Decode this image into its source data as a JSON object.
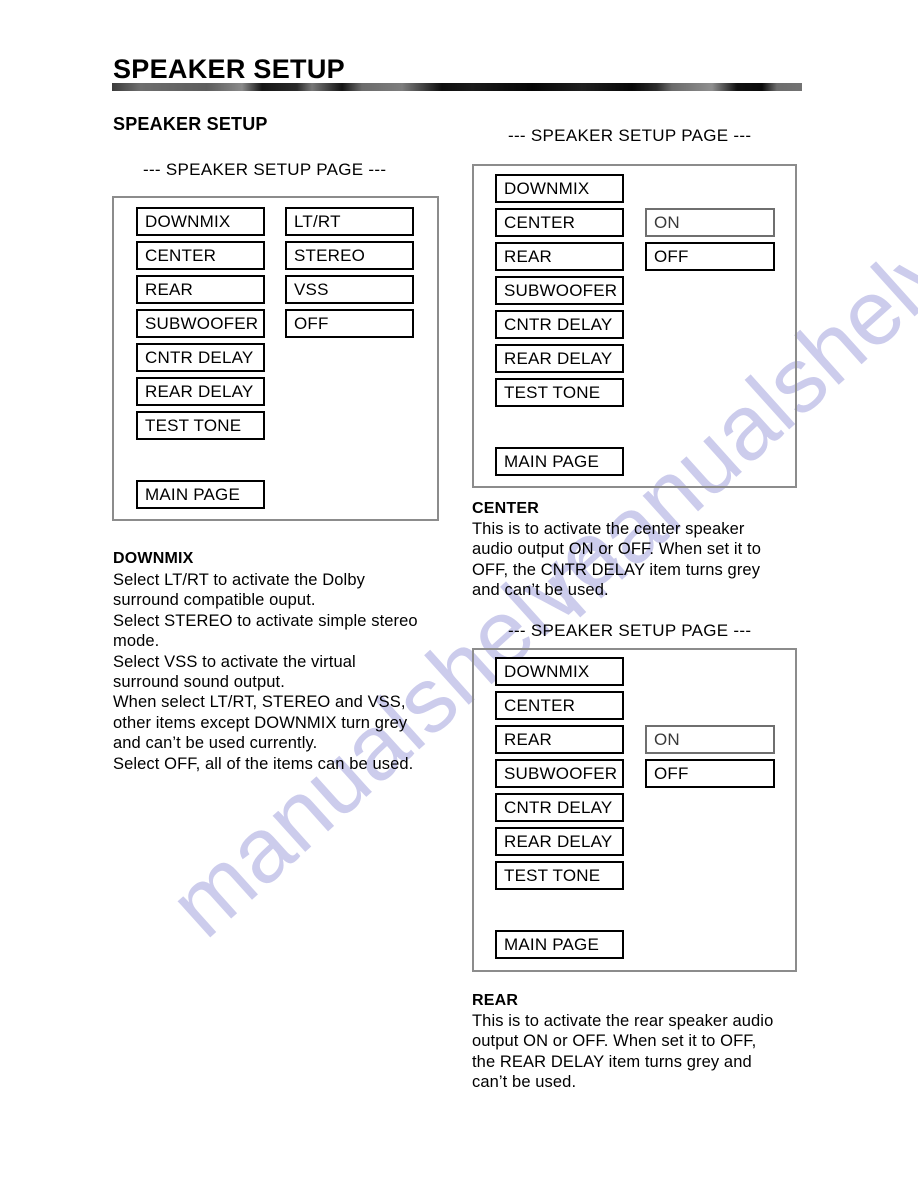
{
  "document": {
    "title": "SPEAKER SETUP",
    "section_heading": "SPEAKER SETUP"
  },
  "panels": [
    {
      "id": "downmix-panel",
      "heading": "--- SPEAKER SETUP PAGE ---",
      "menu_items": [
        "DOWNMIX",
        "CENTER",
        "REAR",
        "SUBWOOFER",
        "CNTR DELAY",
        "REAR DELAY",
        "TEST TONE"
      ],
      "main_page_label": "MAIN PAGE",
      "options": [
        "LT/RT",
        "STEREO",
        "VSS",
        "OFF"
      ]
    },
    {
      "id": "center-panel",
      "heading": "--- SPEAKER SETUP PAGE ---",
      "menu_items": [
        "DOWNMIX",
        "CENTER",
        "REAR",
        "SUBWOOFER",
        "CNTR DELAY",
        "REAR DELAY",
        "TEST TONE"
      ],
      "main_page_label": "MAIN PAGE",
      "options": [
        "ON",
        "OFF"
      ]
    },
    {
      "id": "rear-panel",
      "heading": "--- SPEAKER SETUP PAGE ---",
      "menu_items": [
        "DOWNMIX",
        "CENTER",
        "REAR",
        "SUBWOOFER",
        "CNTR DELAY",
        "REAR DELAY",
        "TEST TONE"
      ],
      "main_page_label": "MAIN PAGE",
      "options": [
        "ON",
        "OFF"
      ]
    }
  ],
  "captions": {
    "downmix": {
      "title": "DOWNMIX",
      "body": "Select LT/RT to activate the Dolby\nsurround compatible ouput.\nSelect STEREO to activate simple stereo\nmode.\nSelect VSS to activate the virtual\nsurround sound output.\nWhen select LT/RT, STEREO and VSS,\nother items except DOWNMIX turn grey\nand can’t be used currently.\nSelect OFF, all of the items can be used."
    },
    "center": {
      "title": "CENTER",
      "body": "This is to activate the center speaker\naudio output ON or OFF. When set it to\nOFF, the CNTR DELAY item turns grey\nand can’t be used."
    },
    "rear": {
      "title": "REAR",
      "body": "This is to activate the rear speaker audio\noutput ON or OFF. When set it to OFF,\nthe REAR DELAY item turns grey and\ncan’t be used."
    }
  },
  "watermark": {
    "left_text": "manualshelve",
    "right_text": "manualshelve.com"
  },
  "colors": {
    "panel_border": "#8c8c8c",
    "box_border": "#000000",
    "text": "#000000",
    "watermark": "#ccccec"
  }
}
